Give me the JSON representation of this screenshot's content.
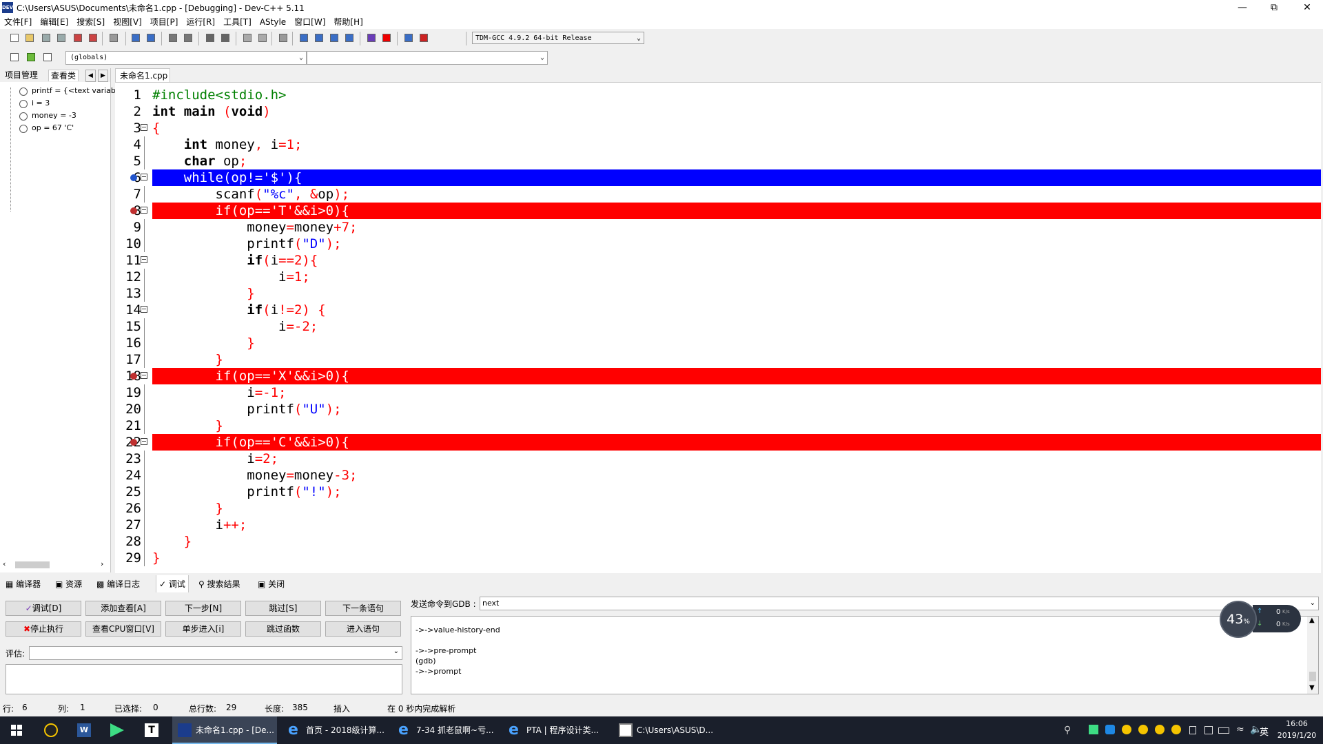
{
  "window": {
    "title": "C:\\Users\\ASUS\\Documents\\未命名1.cpp - [Debugging] - Dev-C++ 5.11",
    "app_icon_text": "DEV"
  },
  "menu": [
    "文件[F]",
    "编辑[E]",
    "搜索[S]",
    "视图[V]",
    "项目[P]",
    "运行[R]",
    "工具[T]",
    "AStyle",
    "窗口[W]",
    "帮助[H]"
  ],
  "toolbar": {
    "compiler": "TDM-GCC 4.9.2 64-bit Release",
    "scope": "(globals)",
    "symbol": ""
  },
  "left_panel": {
    "tabs": [
      "项目管理",
      "查看类"
    ],
    "watches": [
      "printf = {<text variab",
      "i = 3",
      "money = -3",
      "op = 67 'C'"
    ]
  },
  "editor": {
    "tab": "未命名1.cpp",
    "lines": [
      {
        "n": "1",
        "html": "<span class='pp'>#include&lt;stdio.h&gt;</span>"
      },
      {
        "n": "2",
        "html": "<span class='k'>int</span> <span class='k'>main</span> <span class='p'>(</span><span class='k'>void</span><span class='p'>)</span>"
      },
      {
        "n": "3",
        "html": "<span class='p'>{</span>",
        "fold": "box"
      },
      {
        "n": "4",
        "html": "    <span class='k'>int</span> money<span class='p'>,</span> i<span class='p'>=</span><span class='p'>1;</span>"
      },
      {
        "n": "5",
        "html": "    <span class='k'>char</span> op<span class='p'>;</span>"
      },
      {
        "n": "6",
        "html": "    while(op!='$'){",
        "hl": "blue",
        "fold": "box",
        "marker": "current"
      },
      {
        "n": "7",
        "html": "        scanf<span class='p'>(</span><span class='s'>\"%c\"</span><span class='p'>,</span> <span class='p'>&amp;</span>op<span class='p'>);</span>"
      },
      {
        "n": "8",
        "html": "        if(op=='T'&amp;&amp;i&gt;0){",
        "hl": "red",
        "fold": "box",
        "marker": "bp"
      },
      {
        "n": "9",
        "html": "            money<span class='p'>=</span>money<span class='p'>+7;</span>"
      },
      {
        "n": "10",
        "html": "            printf<span class='p'>(</span><span class='s'>\"D\"</span><span class='p'>);</span>"
      },
      {
        "n": "11",
        "html": "            <span class='k'>if</span><span class='p'>(</span>i<span class='p'>==2){</span>",
        "fold": "box"
      },
      {
        "n": "12",
        "html": "                i<span class='p'>=1;</span>"
      },
      {
        "n": "13",
        "html": "            <span class='p'>}</span>"
      },
      {
        "n": "14",
        "html": "            <span class='k'>if</span><span class='p'>(</span>i<span class='p'>!=2) {</span>",
        "fold": "box"
      },
      {
        "n": "15",
        "html": "                i<span class='p'>=-2;</span>"
      },
      {
        "n": "16",
        "html": "            <span class='p'>}</span>"
      },
      {
        "n": "17",
        "html": "        <span class='p'>}</span>"
      },
      {
        "n": "18",
        "html": "        if(op=='X'&amp;&amp;i&gt;0){",
        "hl": "red",
        "fold": "box",
        "marker": "bp"
      },
      {
        "n": "19",
        "html": "            i<span class='p'>=-1;</span>"
      },
      {
        "n": "20",
        "html": "            printf<span class='p'>(</span><span class='s'>\"U\"</span><span class='p'>);</span>"
      },
      {
        "n": "21",
        "html": "        <span class='p'>}</span>"
      },
      {
        "n": "22",
        "html": "        if(op=='C'&amp;&amp;i&gt;0){",
        "hl": "red",
        "fold": "box",
        "marker": "bp"
      },
      {
        "n": "23",
        "html": "            i<span class='p'>=2;</span>"
      },
      {
        "n": "24",
        "html": "            money<span class='p'>=</span>money<span class='p'>-3;</span>"
      },
      {
        "n": "25",
        "html": "            printf<span class='p'>(</span><span class='s'>\"!\"</span><span class='p'>);</span>"
      },
      {
        "n": "26",
        "html": "        <span class='p'>}</span>"
      },
      {
        "n": "27",
        "html": "        i<span class='p'>++;</span>"
      },
      {
        "n": "28",
        "html": "    <span class='p'>}</span>"
      },
      {
        "n": "29",
        "html": "<span class='p'>}</span>"
      }
    ]
  },
  "bottom_tabs": [
    "编译器",
    "资源",
    "编译日志",
    "调试",
    "搜索结果",
    "关闭"
  ],
  "debug": {
    "buttons_row1": [
      "调试[D]",
      "添加查看[A]",
      "下一步[N]",
      "跳过[S]",
      "下一条语句"
    ],
    "buttons_row2": [
      "停止执行",
      "查看CPU窗口[V]",
      "单步进入[i]",
      "跳过函数",
      "进入语句"
    ],
    "eval_label": "评估:",
    "gdb_label": "发送命令到GDB :",
    "gdb_value": "next",
    "output": [
      "->->value-history-end",
      "",
      "->->pre-prompt",
      "(gdb)",
      "->->prompt"
    ]
  },
  "network_widget": {
    "percent": "43",
    "percent_unit": "%",
    "up": "0",
    "down": "0",
    "unit": "K/s"
  },
  "status": {
    "row_label": "行:",
    "row": "6",
    "col_label": "列:",
    "col": "1",
    "sel_label": "已选择:",
    "sel": "0",
    "total_label": "总行数:",
    "total": "29",
    "len_label": "长度:",
    "len": "385",
    "mode": "插入",
    "parse": "在 0 秒内完成解析"
  },
  "taskbar": {
    "tasks": [
      "未命名1.cpp - [De...",
      "首页 - 2018级计算...",
      "7-34 抓老鼠啊~亏...",
      "PTA | 程序设计类...",
      "C:\\Users\\ASUS\\D..."
    ],
    "time": "16:06",
    "date": "2019/1/20",
    "ime": "英",
    "ie_glyph": "e",
    "typora_glyph": "T",
    "word_glyph": "W"
  },
  "colors": {
    "current_line": "#0000ff",
    "breakpoint": "#ff0000",
    "taskbar": "#1a1f2b"
  }
}
